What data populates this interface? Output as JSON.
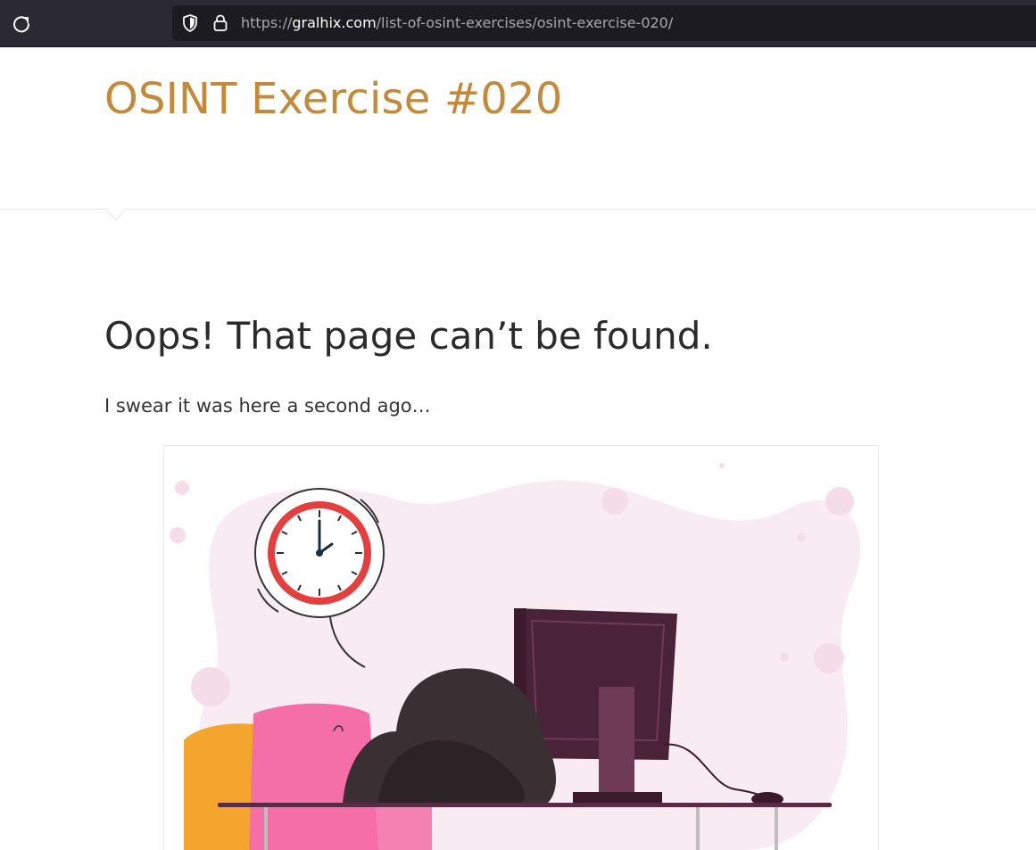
{
  "browser": {
    "url_scheme": "https://",
    "url_host": "gralhix.com",
    "url_path": "/list-of-osint-exercises/osint-exercise-020/",
    "reload_icon": "reload-icon",
    "shield_icon": "shield-icon",
    "lock_icon": "lock-icon"
  },
  "page": {
    "site_title": "OSINT Exercise #020",
    "heading": "Oops! That page can’t be found.",
    "subtext": "I swear it was here a second ago…"
  },
  "colors": {
    "title": "#c48a3a",
    "chrome_bg": "#2b2a33",
    "urlbar_bg": "#1c1b22"
  }
}
